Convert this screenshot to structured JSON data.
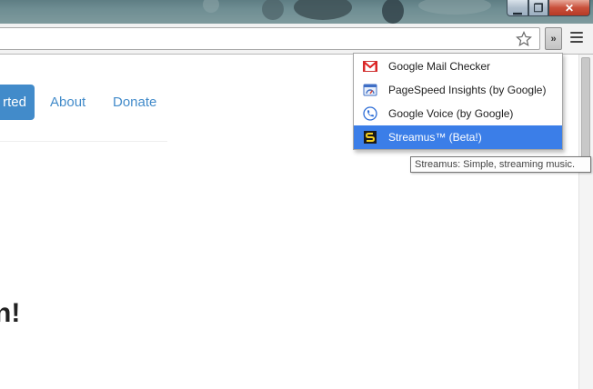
{
  "window": {
    "minimize_icon": "minimize-icon",
    "restore_icon": "restore-icon",
    "close_icon": "close-icon"
  },
  "toolbar": {
    "star_icon": "star-icon",
    "overflow_label": "»",
    "menu_icon": "hamburger-menu-icon"
  },
  "page": {
    "primary_button_label": "rted",
    "nav_links": [
      "About",
      "Donate"
    ],
    "heading_fragment": "n!",
    "accent_color": "#428bca"
  },
  "extension_menu": {
    "items": [
      {
        "label": "Google Mail Checker",
        "icon": "gmail-icon"
      },
      {
        "label": "PageSpeed Insights (by Google)",
        "icon": "pagespeed-icon"
      },
      {
        "label": "Google Voice (by Google)",
        "icon": "google-voice-icon"
      },
      {
        "label": "Streamus™ (Beta!)",
        "icon": "streamus-icon"
      }
    ],
    "highlight_color": "#3b7ee8"
  },
  "tooltip": {
    "text": "Streamus: Simple, streaming music."
  }
}
